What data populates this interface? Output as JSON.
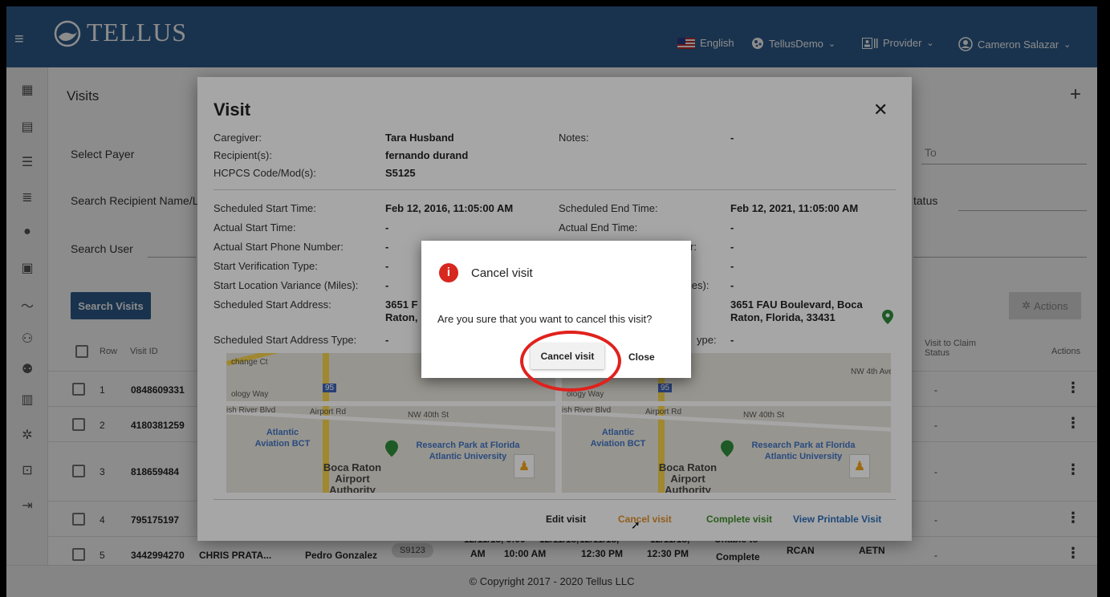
{
  "header": {
    "brand": "TELLUS",
    "language": "English",
    "org": "TellusDemo",
    "role": "Provider",
    "user": "Cameron Salazar"
  },
  "page": {
    "title": "Visits",
    "filters": {
      "select_payer": "Select Payer",
      "search_recipient": "Search Recipient Name/L",
      "search_user": "Search User",
      "to": "To",
      "status": "tatus"
    },
    "search_button": "Search Visits",
    "actions_button": "Actions",
    "columns": {
      "row": "Row",
      "visit_id": "Visit ID",
      "visit_to_claim": "Visit to Claim",
      "status": "Status",
      "actions": "Actions"
    },
    "rows": [
      {
        "row": "1",
        "visit_id": "0848609331",
        "claim": "-"
      },
      {
        "row": "2",
        "visit_id": "4180381259",
        "claim": "-"
      },
      {
        "row": "3",
        "visit_id": "818659484",
        "claim": "-"
      },
      {
        "row": "4",
        "visit_id": "795175197",
        "claim": "-"
      },
      {
        "row": "5",
        "visit_id": "3442994270",
        "claim": "-"
      }
    ],
    "row5": {
      "caregiver": "CHRIS PRATA...",
      "recipient": "Pedro Gonzalez",
      "code": "S9123",
      "c1a": "12/11/18, 9:00",
      "c1b": "AM",
      "c2a": "12/11/18,",
      "c2b": "10:00 AM",
      "c3a": "12/11/18,",
      "c3b": "12:30 PM",
      "c4a": "12/11/18,",
      "c4b": "12:30 PM",
      "c5a": "Unable to",
      "c5b": "Complete",
      "payer": "RCAN",
      "prog": "AETN"
    },
    "footer": "© Copyright 2017 - 2020 Tellus LLC"
  },
  "visit": {
    "title": "Visit",
    "caregiver_label": "Caregiver:",
    "caregiver": "Tara Husband",
    "recipient_label": "Recipient(s):",
    "recipient": "fernando durand",
    "hcpcs_label": "HCPCS Code/Mod(s):",
    "hcpcs": "S5125",
    "notes_label": "Notes:",
    "notes": "-",
    "sched_start_label": "Scheduled Start Time:",
    "sched_start": "Feb 12, 2016, 11:05:00 AM",
    "sched_end_label": "Scheduled End Time:",
    "sched_end": "Feb 12, 2021, 11:05:00 AM",
    "actual_start_label": "Actual Start Time:",
    "actual_start": "-",
    "actual_end_label": "Actual End Time:",
    "actual_end": "-",
    "start_phone_label": "Actual Start Phone Number:",
    "start_phone": "-",
    "end_phone_partial": "r:",
    "end_phone": "-",
    "start_verif_label": "Start Verification Type:",
    "start_verif": "-",
    "end_verif": "-",
    "start_var_label": "Start Location Variance (Miles):",
    "start_var": "-",
    "end_var_partial": "iles):",
    "end_var": "-",
    "sched_addr_label": "Scheduled Start Address:",
    "sched_addr_l1": "3651 F",
    "sched_addr_l2": "Raton,",
    "end_addr_l1": "3651 FAU Boulevard, Boca",
    "end_addr_l2": "Raton, Florida, 33431",
    "addr_type_label": "Scheduled Start Address Type:",
    "addr_type": "-",
    "end_addr_type_partial": "ype:",
    "end_addr_type": "-",
    "map": {
      "road1": "ology Way",
      "road2": "ish River Blvd",
      "road3": "Airport Rd",
      "road4": "NW 40th St",
      "road5": "NW 4th Ave",
      "place1": "Atlantic Aviation BCT",
      "place2": "Research Park at Florida Atlantic University",
      "place3": "Boca Raton Airport Authority",
      "highway": "95",
      "street_v": "change Ct"
    },
    "links": {
      "edit": "Edit visit",
      "cancel": "Cancel visit",
      "complete": "Complete visit",
      "print": "View Printable Visit"
    }
  },
  "confirm": {
    "title": "Cancel visit",
    "message": "Are you sure that you want to cancel this visit?",
    "confirm_button": "Cancel visit",
    "close_button": "Close"
  },
  "colors": {
    "header": "#2f5d8f",
    "accent_orange": "#e0912c",
    "accent_green": "#3f8f2a",
    "link_blue": "#2f6fb8",
    "danger": "#d7271f"
  }
}
